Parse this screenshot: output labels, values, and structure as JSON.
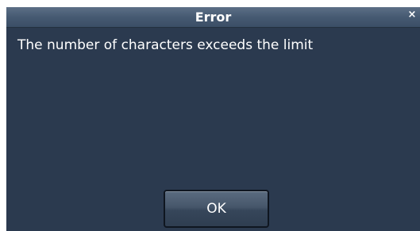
{
  "dialog": {
    "title": "Error",
    "close_glyph": "×",
    "message": "The number of characters exceeds the limit",
    "ok_label": "OK"
  },
  "colors": {
    "dialog_background": "#2b3a4f",
    "titlebar": "#465a72",
    "text": "#ffffff"
  },
  "icons": {
    "close": "close-icon"
  }
}
